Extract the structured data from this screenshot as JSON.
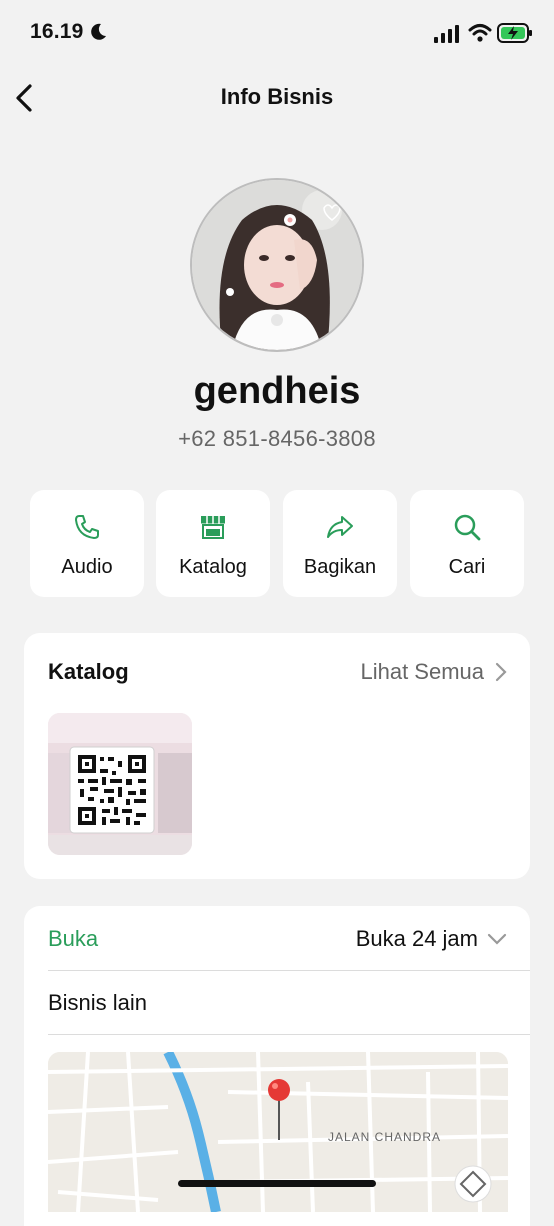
{
  "status": {
    "time": "16.19"
  },
  "nav": {
    "title": "Info Bisnis"
  },
  "profile": {
    "name": "gendheis",
    "phone": "+62 851-8456-3808"
  },
  "actions": [
    {
      "label": "Audio",
      "icon": "phone-icon"
    },
    {
      "label": "Katalog",
      "icon": "store-icon"
    },
    {
      "label": "Bagikan",
      "icon": "share-icon"
    },
    {
      "label": "Cari",
      "icon": "search-icon"
    }
  ],
  "catalog": {
    "title": "Katalog",
    "see_all": "Lihat Semua"
  },
  "info": {
    "open_label": "Buka",
    "hours": "Buka 24 jam",
    "other_business": "Bisnis lain"
  },
  "map": {
    "street_label": "JALAN CHANDRA"
  },
  "colors": {
    "accent": "#2a9d5a",
    "background": "#f2f2f2",
    "card": "#ffffff"
  }
}
